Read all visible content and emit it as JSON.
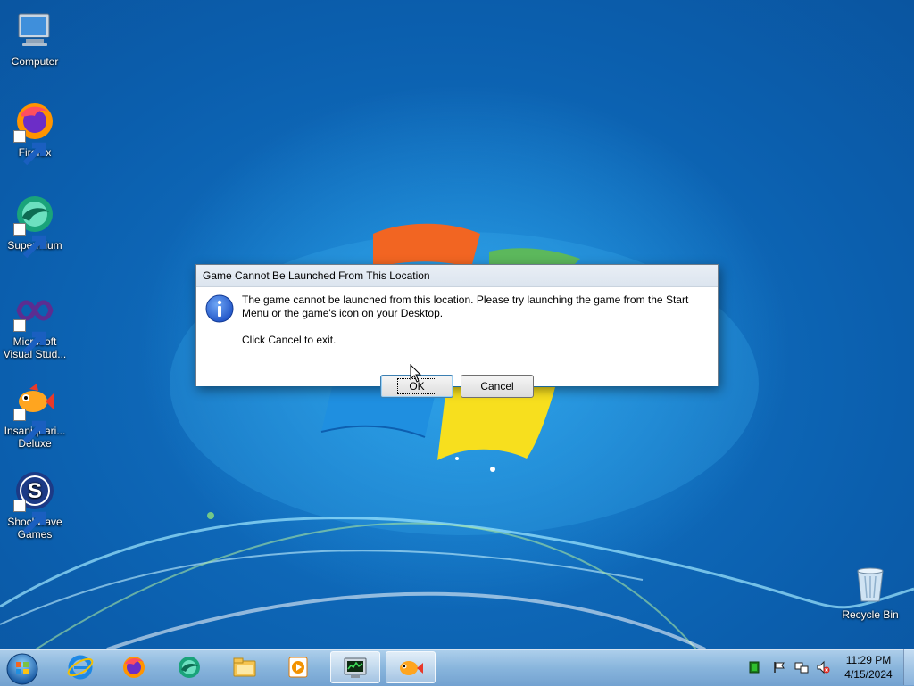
{
  "desktop": {
    "icons": [
      {
        "label_line1": "Computer",
        "label_line2": ""
      },
      {
        "label_line1": "Firefox",
        "label_line2": ""
      },
      {
        "label_line1": "Supermium",
        "label_line2": ""
      },
      {
        "label_line1": "Microsoft",
        "label_line2": "Visual Stud..."
      },
      {
        "label_line1": "Insaniquari...",
        "label_line2": "Deluxe"
      },
      {
        "label_line1": "Shockwave",
        "label_line2": "Games"
      },
      {
        "label_line1": "Recycle Bin",
        "label_line2": ""
      }
    ]
  },
  "dialog": {
    "title": "Game Cannot Be Launched From This Location",
    "message_line1": "The game cannot be launched from this location.  Please try launching the game from the Start",
    "message_line1b": "Menu or the game's icon on your Desktop.",
    "message_line2": "Click Cancel to exit.",
    "ok_label": "OK",
    "cancel_label": "Cancel",
    "icon": "info-icon"
  },
  "taskbar": {
    "pinned": [
      "internet-explorer-icon",
      "firefox-icon",
      "supermium-icon",
      "file-explorer-icon",
      "media-player-icon"
    ],
    "running": [
      "task-manager-icon",
      "insaniquarium-icon"
    ]
  },
  "tray": {
    "time": "11:29 PM",
    "date": "4/15/2024",
    "icons": [
      "network-status-icon",
      "action-center-flag-icon",
      "network-icon",
      "volume-muted-icon"
    ]
  },
  "colors": {
    "desktop_blue": "#0b5fae",
    "dialog_bg": "#f0f0f0",
    "info_blue": "#1c5bd6"
  }
}
